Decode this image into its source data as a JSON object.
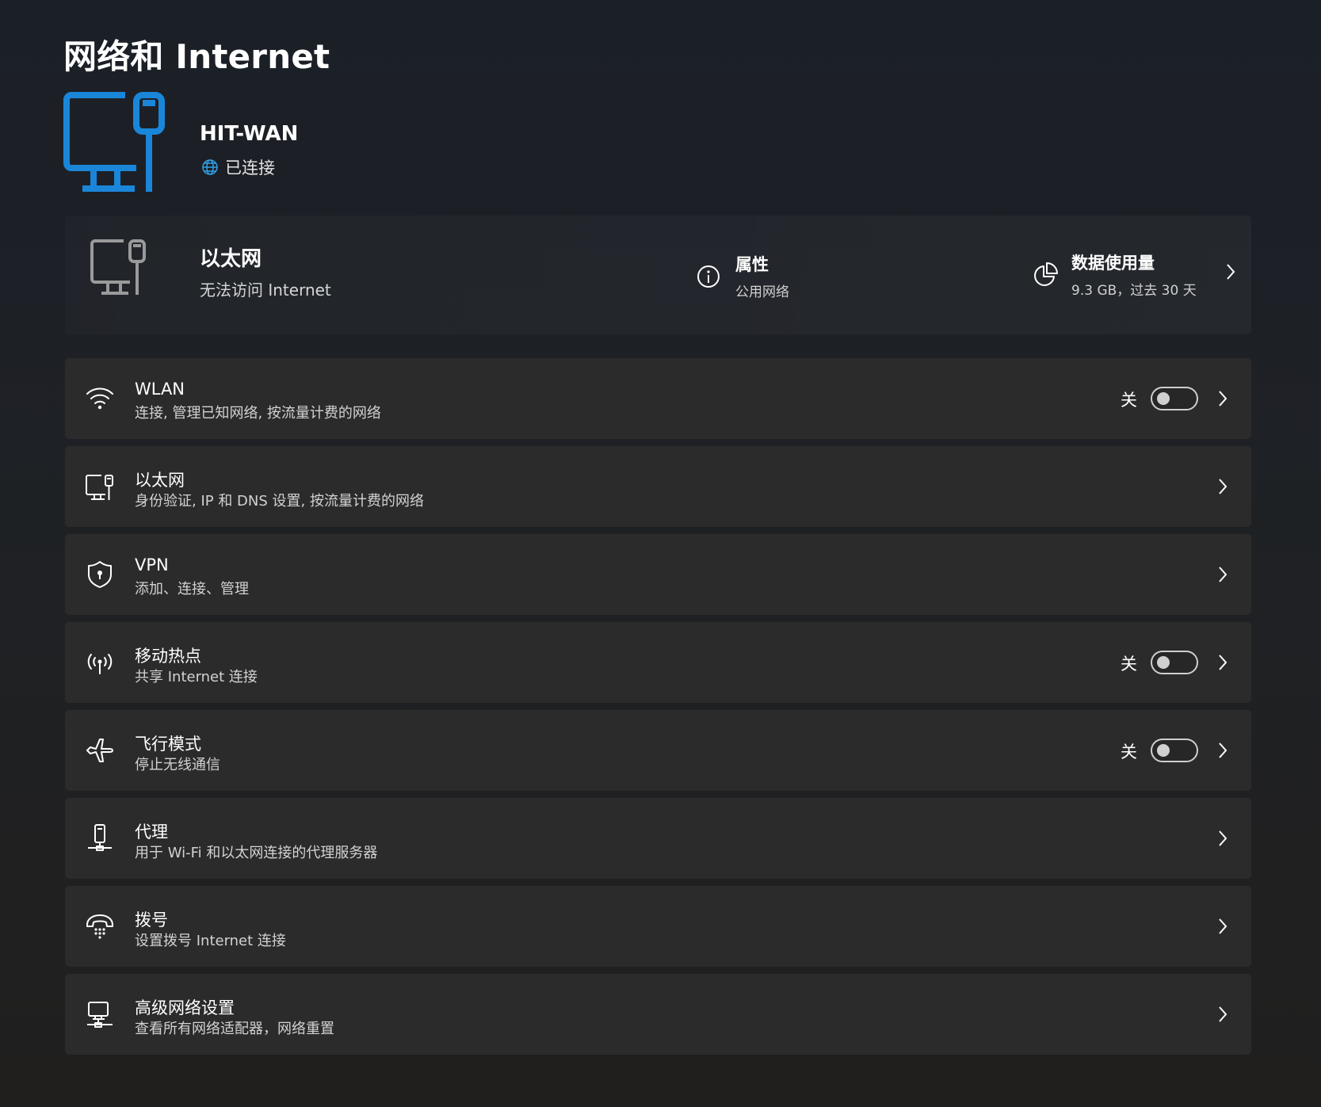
{
  "page": {
    "title": "网络和 Internet"
  },
  "hero": {
    "network_name": "HIT-WAN",
    "status": "已连接"
  },
  "ethernet_card": {
    "title": "以太网",
    "subtitle": "无法访问 Internet",
    "properties": {
      "title": "属性",
      "value": "公用网络"
    },
    "data_usage": {
      "title": "数据使用量",
      "value": "9.3 GB，过去 30 天"
    }
  },
  "settings": [
    {
      "id": "wlan",
      "icon": "wifi-icon",
      "title": "WLAN",
      "subtitle": "连接, 管理已知网络, 按流量计费的网络",
      "toggle": {
        "label": "关",
        "on": false
      }
    },
    {
      "id": "ethernet",
      "icon": "ethernet-icon",
      "title": "以太网",
      "subtitle": "身份验证, IP 和 DNS 设置, 按流量计费的网络"
    },
    {
      "id": "vpn",
      "icon": "shield-icon",
      "title": "VPN",
      "subtitle": "添加、连接、管理"
    },
    {
      "id": "hotspot",
      "icon": "hotspot-icon",
      "title": "移动热点",
      "subtitle": "共享 Internet 连接",
      "toggle": {
        "label": "关",
        "on": false
      }
    },
    {
      "id": "airplane",
      "icon": "airplane-icon",
      "title": "飞行模式",
      "subtitle": "停止无线通信",
      "toggle": {
        "label": "关",
        "on": false
      }
    },
    {
      "id": "proxy",
      "icon": "proxy-icon",
      "title": "代理",
      "subtitle": "用于 Wi-Fi 和以太网连接的代理服务器"
    },
    {
      "id": "dialup",
      "icon": "dialup-icon",
      "title": "拨号",
      "subtitle": "设置拨号 Internet 连接"
    },
    {
      "id": "advanced",
      "icon": "network-adapter-icon",
      "title": "高级网络设置",
      "subtitle": "查看所有网络适配器，网络重置"
    }
  ],
  "colors": {
    "accent": "#1a86d9",
    "row_bg": "#2b2b2b",
    "text": "#ffffff",
    "subtext": "#d2d2d2"
  }
}
